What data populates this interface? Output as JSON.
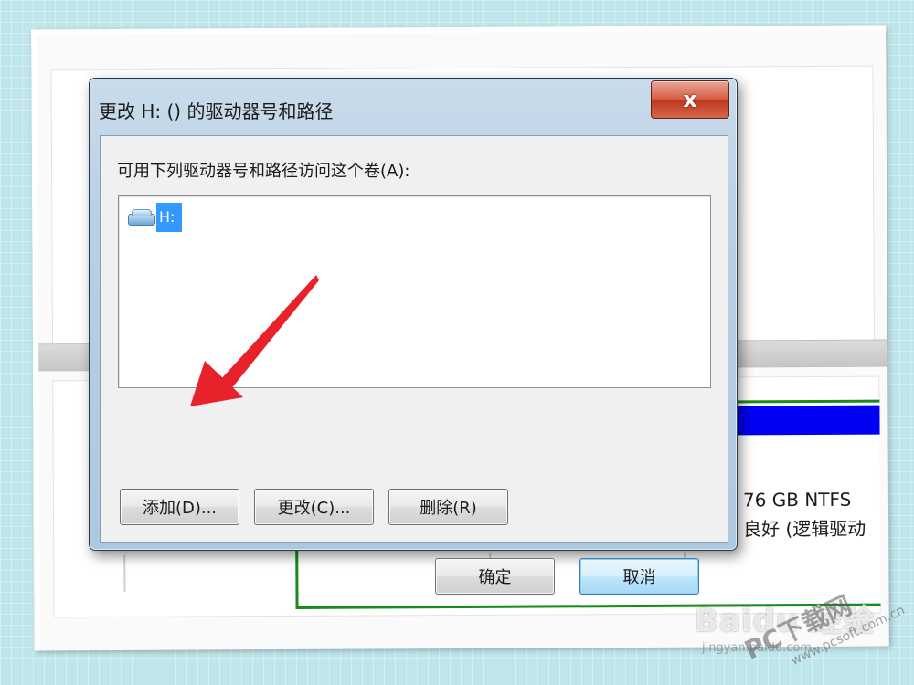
{
  "background_window": {
    "volume_info": {
      "size_text": "76 GB NTFS",
      "status_text": "良好 (逻辑驱动"
    },
    "volume_bar_color": "#0000f2",
    "volume_border_color": "#168c1a"
  },
  "dialog": {
    "title": "更改 H: () 的驱动器号和路径",
    "close_label": "x",
    "instruction": "可用下列驱动器号和路径访问这个卷(A):",
    "list_items": [
      {
        "label": "H:",
        "icon": "drive-icon",
        "selected": true
      }
    ],
    "buttons": {
      "add": "添加(D)...",
      "change": "更改(C)...",
      "remove": "删除(R)",
      "ok": "确定",
      "cancel": "取消"
    },
    "default_button": "cancel"
  },
  "annotation": {
    "type": "arrow",
    "color": "#e8222b",
    "points_to": "add"
  },
  "watermark": {
    "main": "Baidu 经验",
    "sub": "jingyan.baidu.com",
    "pc": "PC下载网",
    "site": "www.pcsoft.com.cn"
  }
}
